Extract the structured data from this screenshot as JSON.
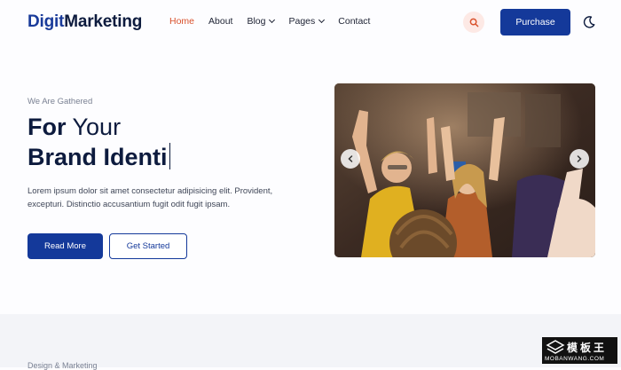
{
  "header": {
    "logo_part1": "Digit",
    "logo_part2": "Marketing",
    "nav": [
      {
        "label": "Home",
        "active": true
      },
      {
        "label": "About"
      },
      {
        "label": "Blog",
        "dropdown": true
      },
      {
        "label": "Pages",
        "dropdown": true
      },
      {
        "label": "Contact"
      }
    ],
    "purchase_label": "Purchase",
    "icons": {
      "search": "search-icon",
      "theme": "moon-icon"
    }
  },
  "hero": {
    "eyebrow": "We Are Gathered",
    "line1_bold": "For",
    "line1_rest": " Your",
    "line2": "Brand Identi",
    "description": "Lorem ipsum dolor sit amet consectetur adipisicing elit. Provident, excepturi. Distinctio accusantium fugit odit fugit ipsam.",
    "read_more": "Read More",
    "get_started": "Get Started"
  },
  "slider": {
    "prev_icon": "chevron-left-icon",
    "next_icon": "chevron-right-icon"
  },
  "section2": {
    "label": "Design & Marketing"
  },
  "watermark": {
    "title": "模板王",
    "sub": "MOBANWANG.COM"
  },
  "colors": {
    "brand": "#14399a",
    "accent": "#d9512c",
    "text": "#0d1b3e"
  }
}
